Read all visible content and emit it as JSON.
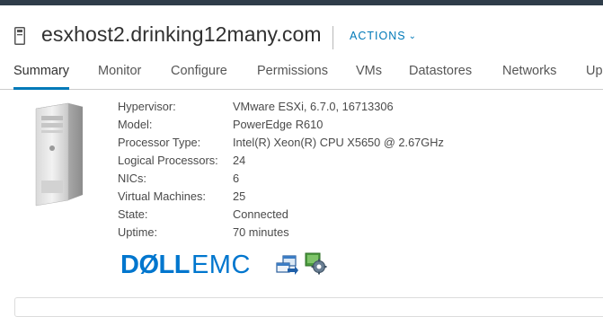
{
  "header": {
    "host_name": "esxhost2.drinking12many.com",
    "actions_label": "ACTIONS"
  },
  "tabs": [
    {
      "label": "Summary",
      "active": true
    },
    {
      "label": "Monitor",
      "active": false
    },
    {
      "label": "Configure",
      "active": false
    },
    {
      "label": "Permissions",
      "active": false
    },
    {
      "label": "VMs",
      "active": false
    },
    {
      "label": "Datastores",
      "active": false
    },
    {
      "label": "Networks",
      "active": false
    },
    {
      "label": "Up",
      "active": false
    }
  ],
  "properties": [
    {
      "label": "Hypervisor:",
      "value": "VMware ESXi, 6.7.0, 16713306"
    },
    {
      "label": "Model:",
      "value": "PowerEdge R610"
    },
    {
      "label": "Processor Type:",
      "value": "Intel(R) Xeon(R) CPU X5650 @ 2.67GHz"
    },
    {
      "label": "Logical Processors:",
      "value": "24"
    },
    {
      "label": "NICs:",
      "value": "6"
    },
    {
      "label": "Virtual Machines:",
      "value": "25"
    },
    {
      "label": "State:",
      "value": "Connected"
    },
    {
      "label": "Uptime:",
      "value": "70 minutes"
    }
  ],
  "vendor_logo": {
    "dell": "DØLL",
    "emc": "EMC"
  },
  "icons": {
    "host": "host-icon",
    "chevron": "chevron-down-icon",
    "server": "server-image",
    "remote_console": "remote-console-icon",
    "settings": "settings-gear-icon"
  },
  "colors": {
    "accent": "#0079b8",
    "topbar": "#2f3d4a",
    "dell_blue": "#0076ce"
  }
}
